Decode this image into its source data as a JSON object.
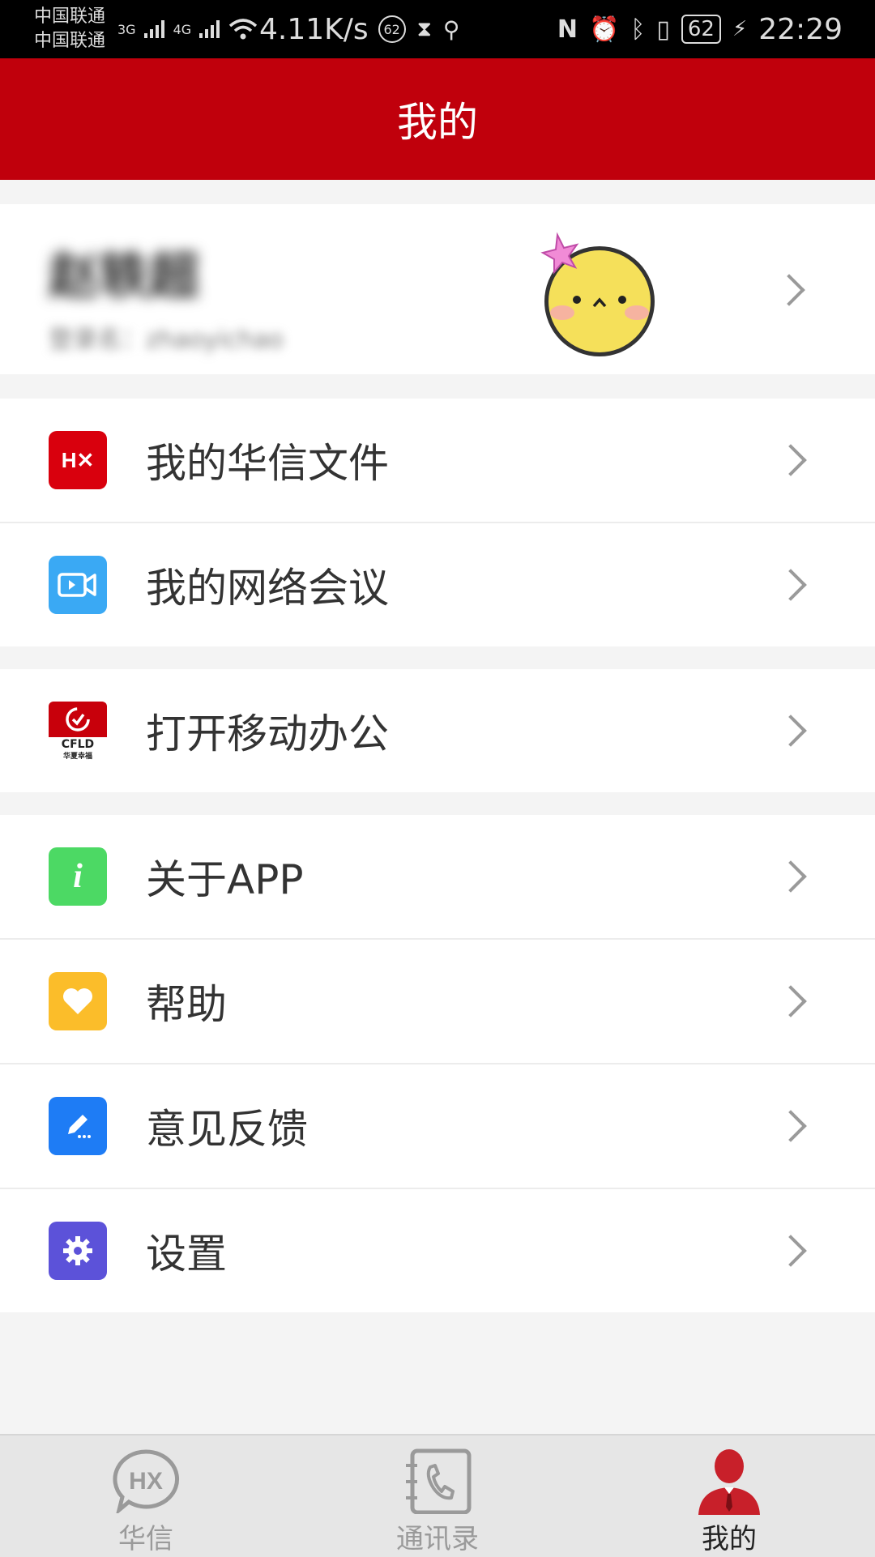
{
  "status_bar": {
    "carrier_1": "中国联通",
    "carrier_2": "中国联通",
    "net_1": "3G",
    "net_2": "4G",
    "speed": "4.11K/s",
    "badge": "62",
    "battery": "62",
    "time": "22:29"
  },
  "header": {
    "title": "我的"
  },
  "profile": {
    "name": "赵轶超",
    "account": "登录名：zhaoyichao"
  },
  "menu_group_1": [
    {
      "label": "我的华信文件",
      "icon": "hx-file-icon",
      "color": "#d9000d"
    },
    {
      "label": "我的网络会议",
      "icon": "video-meeting-icon",
      "color": "#3aa9f4"
    }
  ],
  "menu_group_2": [
    {
      "label": "打开移动办公",
      "icon": "cfld-office-icon",
      "color": "#c8000b",
      "sub": "CFLD",
      "sub2": "华夏幸福"
    }
  ],
  "menu_group_3": [
    {
      "label": "关于APP",
      "icon": "info-icon",
      "color": "#4cd964"
    },
    {
      "label": "帮助",
      "icon": "heart-icon",
      "color": "#fbbd2a"
    },
    {
      "label": "意见反馈",
      "icon": "edit-icon",
      "color": "#1e7cf5"
    },
    {
      "label": "设置",
      "icon": "gear-icon",
      "color": "#5c52d9"
    }
  ],
  "tabs": [
    {
      "label": "华信",
      "icon": "hx-chat-icon",
      "active": false
    },
    {
      "label": "通讯录",
      "icon": "contacts-icon",
      "active": false
    },
    {
      "label": "我的",
      "icon": "person-icon",
      "active": true
    }
  ],
  "colors": {
    "brand_red": "#c0000c",
    "background": "#f4f4f4"
  }
}
